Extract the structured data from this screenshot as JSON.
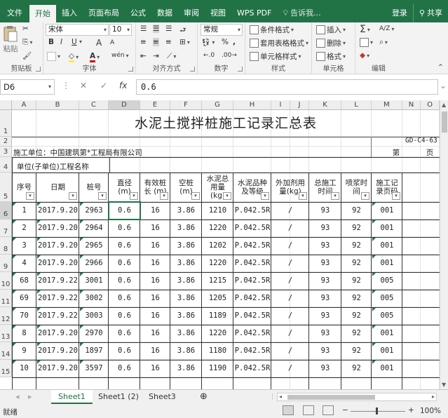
{
  "ribbon_tabs": [
    "文件",
    "开始",
    "插入",
    "页面布局",
    "公式",
    "数据",
    "审阅",
    "视图",
    "WPS PDF"
  ],
  "tell_me": "告诉我...",
  "login": "登录",
  "share": "共享",
  "clipboard": {
    "paste": "粘贴",
    "label": "剪贴板"
  },
  "font": {
    "name": "宋体",
    "size": "10",
    "label": "字体",
    "bold": "B",
    "italic": "I",
    "underline": "U",
    "grow": "A",
    "shrink": "A",
    "color": "A",
    "phonetic": "wén"
  },
  "alignment": {
    "label": "对齐方式"
  },
  "number": {
    "format": "常规",
    "label": "数字",
    "percent": "%",
    "comma": ","
  },
  "styles": {
    "conditional": "条件格式",
    "table": "套用表格格式",
    "cell": "单元格样式",
    "label": "样式"
  },
  "cells": {
    "insert": "插入",
    "delete": "删除",
    "format": "格式",
    "label": "单元格"
  },
  "editing": {
    "label": "编辑",
    "sum": "Σ",
    "sort": "A/Z",
    "find": "⌕"
  },
  "formula_bar": {
    "namebox": "D6",
    "cancel": "✕",
    "enter": "✓",
    "fx": "fx",
    "value": "0.6"
  },
  "columns": [
    "A",
    "B",
    "C",
    "D",
    "E",
    "F",
    "G",
    "H",
    "I",
    "J",
    "K",
    "L",
    "M",
    "N",
    "O"
  ],
  "rows": [
    "1",
    "2",
    "3",
    "4",
    "5",
    "6",
    "7",
    "8",
    "9",
    "10",
    "11",
    "12",
    "13",
    "14",
    "15"
  ],
  "sheet": {
    "title": "水泥土搅拌桩施工记录汇总表",
    "code": "GD-C4-63",
    "unit_label": "施工单位：中国建筑第*工程局有限公司",
    "page_di": "第",
    "page_ye": "页",
    "project_label": "单位(子单位)工程名称",
    "headers": [
      "序号",
      "日期",
      "桩号",
      "直径 (m)",
      "有效桩长 (m)",
      "空桩 (m)",
      "水泥总用量 (kg)",
      "水泥品种及等级",
      "外加剂用量(kg)",
      "总施工时间",
      "喷浆时间",
      "施工记录页码"
    ],
    "data": [
      [
        "1",
        "2017.9.20",
        "2963",
        "0.6",
        "16",
        "3.86",
        "1210",
        "P.042.5R",
        "/",
        "93",
        "92",
        "001"
      ],
      [
        "2",
        "2017.9.20",
        "2964",
        "0.6",
        "16",
        "3.86",
        "1220",
        "P.042.5R",
        "/",
        "93",
        "92",
        "001"
      ],
      [
        "3",
        "2017.9.20",
        "2965",
        "0.6",
        "16",
        "3.86",
        "1202",
        "P.042.5R",
        "/",
        "93",
        "92",
        "001"
      ],
      [
        "4",
        "2017.9.20",
        "2966",
        "0.6",
        "16",
        "3.86",
        "1220",
        "P.042.5R",
        "/",
        "93",
        "92",
        "001"
      ],
      [
        "68",
        "2017.9.22",
        "3001",
        "0.6",
        "16",
        "3.86",
        "1215",
        "P.042.5R",
        "/",
        "93",
        "92",
        "005"
      ],
      [
        "69",
        "2017.9.22",
        "3002",
        "0.6",
        "16",
        "3.86",
        "1205",
        "P.042.5R",
        "/",
        "93",
        "92",
        "005"
      ],
      [
        "70",
        "2017.9.22",
        "3003",
        "0.6",
        "16",
        "3.86",
        "1189",
        "P.042.5R",
        "/",
        "93",
        "92",
        "005"
      ],
      [
        "8",
        "2017.9.20",
        "2970",
        "0.6",
        "16",
        "3.86",
        "1220",
        "P.042.5R",
        "/",
        "93",
        "92",
        "001"
      ],
      [
        "9",
        "2017.9.20",
        "1897",
        "0.6",
        "16",
        "3.86",
        "1180",
        "P.042.5R",
        "/",
        "93",
        "92",
        "001"
      ],
      [
        "10",
        "2017.9.20",
        "3597",
        "0.6",
        "16",
        "3.86",
        "1190",
        "P.042.5R",
        "/",
        "93",
        "92",
        "001"
      ]
    ]
  },
  "sheet_tabs": [
    "Sheet1",
    "Sheet1 (2)",
    "Sheet3"
  ],
  "add_sheet": "⊕",
  "status": {
    "ready": "就绪",
    "zoom": "100%",
    "minus": "−",
    "plus": "+"
  },
  "colors": {
    "brand": "#217346"
  }
}
